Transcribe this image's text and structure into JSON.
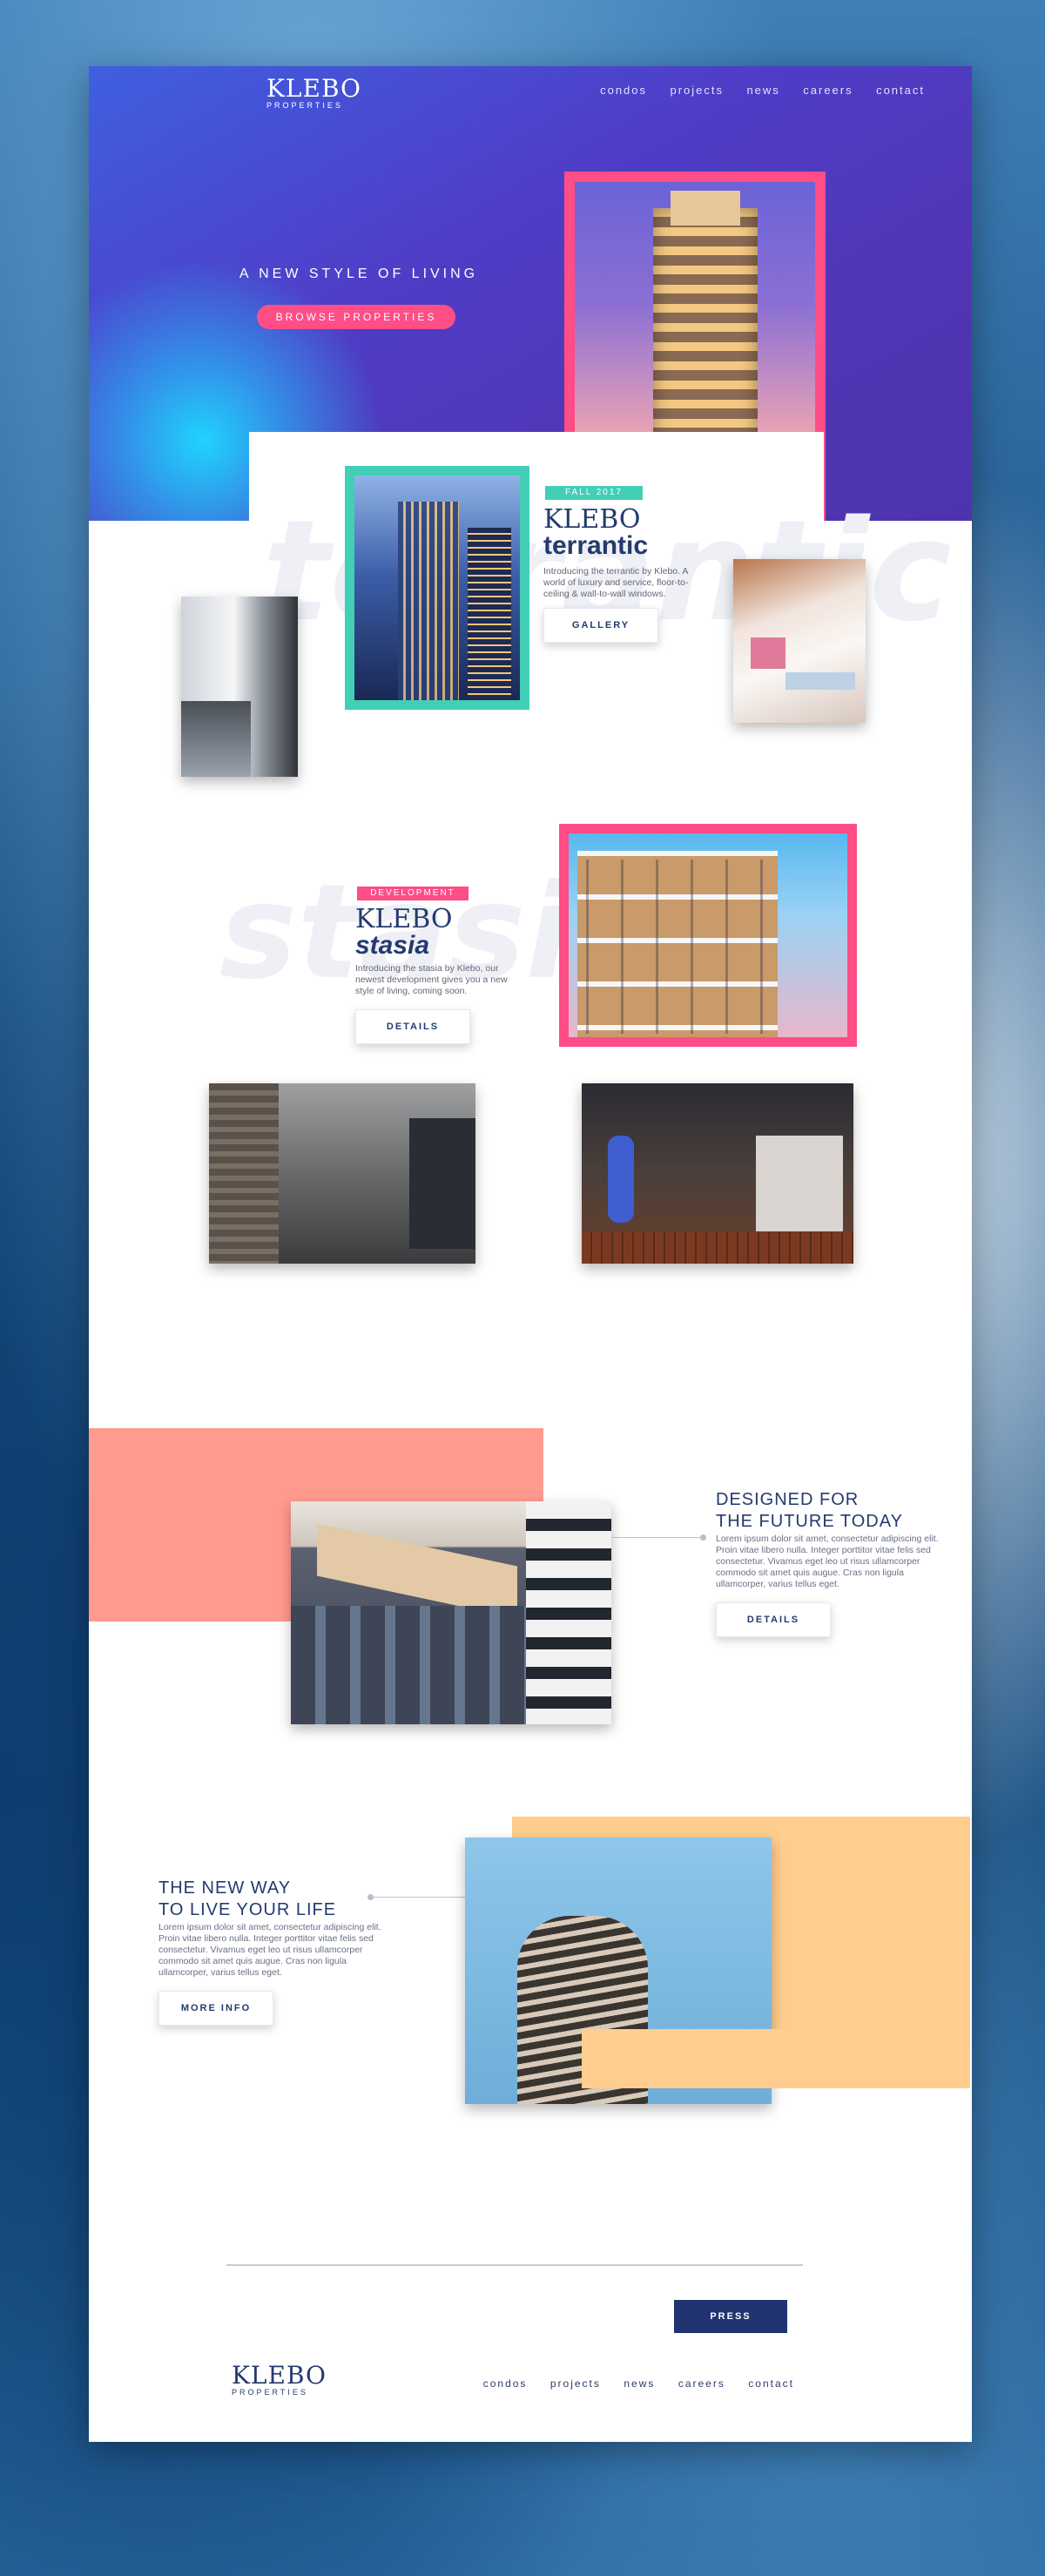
{
  "brand": {
    "logo_main": "KLEBO",
    "logo_sub": "PROPERTIES"
  },
  "nav": {
    "items": [
      "condos",
      "projects",
      "news",
      "careers",
      "contact"
    ]
  },
  "hero": {
    "tagline": "A NEW STYLE OF LIVING",
    "cta_label": "BROWSE PROPERTIES"
  },
  "terrantic": {
    "badge": "FALL 2017",
    "title_line1": "KLEBO",
    "title_line2": "terrantic",
    "ghost_word": "terrantic",
    "description": "Introducing the terrantic by Klebo. A world of luxury and service, floor-to-ceiling & wall-to-wall windows.",
    "button_label": "GALLERY"
  },
  "stasia": {
    "badge": "DEVELOPMENT",
    "title_line1": "KLEBO",
    "title_line2": "stasia",
    "ghost_word": "stasia",
    "description": "Introducing the stasia by Klebo, our newest development gives you a new style of living, coming soon.",
    "button_label": "DETAILS"
  },
  "future": {
    "heading_line1": "DESIGNED FOR",
    "heading_line2": "THE FUTURE TODAY",
    "body": "Lorem ipsum dolor sit amet, consectetur adipiscing elit. Proin vitae libero nulla. Integer porttitor vitae felis sed consectetur. Vivamus eget leo ut risus ullamcorper commodo sit amet quis augue. Cras non ligula ullamcorper, varius tellus eget.",
    "button_label": "DETAILS"
  },
  "newway": {
    "heading_line1": "THE NEW WAY",
    "heading_line2": "TO LIVE YOUR LIFE",
    "body": "Lorem ipsum dolor sit amet, consectetur adipiscing elit. Proin vitae libero nulla. Integer porttitor vitae felis sed consectetur. Vivamus eget leo ut risus ullamcorper commodo sit amet quis augue. Cras non ligula ullamcorper, varius tellus eget.",
    "button_label": "MORE INFO"
  },
  "press": {
    "button_label": "PRESS"
  },
  "colors": {
    "hero_start": "#3f5fe0",
    "hero_end": "#4d33ad",
    "accent_pink": "#ff4d86",
    "accent_teal": "#42cfb6",
    "navy": "#243a6e",
    "coral_block": "#ff9a8f",
    "peach_block": "#ffcd8e",
    "press_button": "#1f3470"
  }
}
